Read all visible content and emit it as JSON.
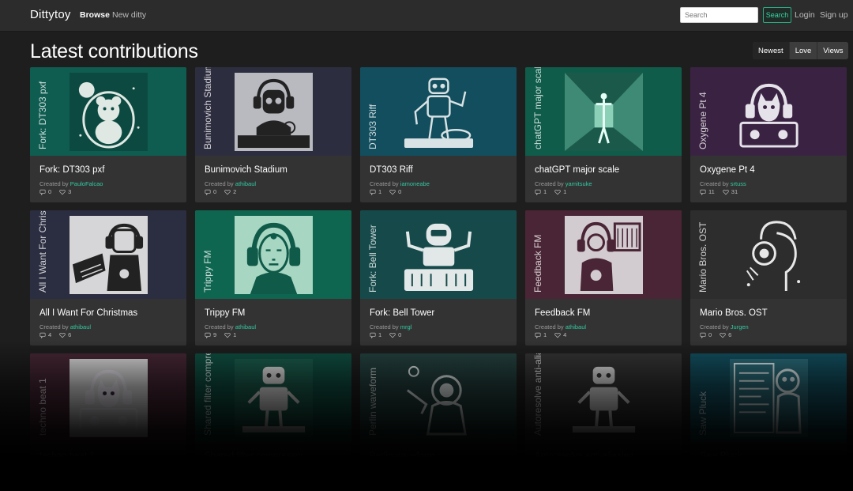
{
  "nav": {
    "brand": "Dittytoy",
    "browse": "Browse",
    "new_ditty": "New ditty",
    "search_placeholder": "Search",
    "search_button": "Search",
    "login": "Login",
    "signup": "Sign up"
  },
  "page_title": "Latest contributions",
  "sort_options": [
    "Newest",
    "Love",
    "Views"
  ],
  "sort_selected": "Newest",
  "created_by_label": "Created by",
  "cards": [
    {
      "title": "Fork: DT303 pxf",
      "author": "PauloFalcao",
      "comments": "0",
      "loves": "3",
      "bg": "#0f5c50",
      "art_bg": "#0c4a41",
      "art": "bear-icon"
    },
    {
      "title": "Bunimovich Stadium",
      "author": "athibaul",
      "comments": "0",
      "loves": "2",
      "bg": "#2d2d40",
      "art_bg": "#b9bac0",
      "art": "headphone-robot-icon"
    },
    {
      "title": "DT303 Riff",
      "author": "iamoneabe",
      "comments": "1",
      "loves": "0",
      "bg": "#124e5e",
      "art_bg": "#124e5e",
      "art": "robot-dj-icon"
    },
    {
      "title": "chatGPT major scale",
      "author": "yamitsuke",
      "comments": "1",
      "loves": "1",
      "bg": "#0f5c4a",
      "art_bg": "#2a6e5c",
      "art": "corridor-figure-icon"
    },
    {
      "title": "Oxygene Pt 4",
      "author": "srtuss",
      "comments": "11",
      "loves": "31",
      "bg": "#3a2342",
      "art_bg": "#3a2342",
      "art": "cat-headphones-icon"
    },
    {
      "title": "All I Want For Christmas",
      "author": "athibaul",
      "comments": "4",
      "loves": "6",
      "bg": "#2b2d40",
      "art_bg": "#d6d6d8",
      "art": "keyboard-player-icon"
    },
    {
      "title": "Trippy FM",
      "author": "athibaul",
      "comments": "9",
      "loves": "1",
      "bg": "#0f6650",
      "art_bg": "#a7d6c2",
      "art": "face-headphones-icon"
    },
    {
      "title": "Fork: Bell Tower",
      "author": "mrgl",
      "comments": "1",
      "loves": "0",
      "bg": "#164a4a",
      "art_bg": "#164a4a",
      "art": "robot-mixer-icon"
    },
    {
      "title": "Feedback FM",
      "author": "athibaul",
      "comments": "1",
      "loves": "4",
      "bg": "#4a2535",
      "art_bg": "#d2ccd0",
      "art": "synth-player-icon"
    },
    {
      "title": "Mario Bros. OST",
      "author": "Jurgen",
      "comments": "0",
      "loves": "6",
      "bg": "#2d2d2d",
      "art_bg": "#2d2d2d",
      "art": "profile-headphones-icon"
    },
    {
      "title": "techno beat 1",
      "author": "",
      "comments": "",
      "loves": "",
      "bg": "#452634",
      "art_bg": "#d8d8d8",
      "art": "cat-headphones-icon"
    },
    {
      "title": "Shared filter compressor",
      "author": "",
      "comments": "",
      "loves": "",
      "bg": "#0f4d40",
      "art_bg": "#1a5a4a",
      "art": "robot-icon"
    },
    {
      "title": "Perlin waveform",
      "author": "",
      "comments": "",
      "loves": "",
      "bg": "#23403e",
      "art_bg": "#23403e",
      "art": "astronaut-icon"
    },
    {
      "title": "Autoresolve anti-aliasing",
      "author": "",
      "comments": "",
      "loves": "",
      "bg": "#333333",
      "art_bg": "#333333",
      "art": "robot-icon"
    },
    {
      "title": "Saw Pluck",
      "author": "",
      "comments": "",
      "loves": "",
      "bg": "#124e5e",
      "art_bg": "#2a6a78",
      "art": "robot-terminal-icon"
    }
  ]
}
